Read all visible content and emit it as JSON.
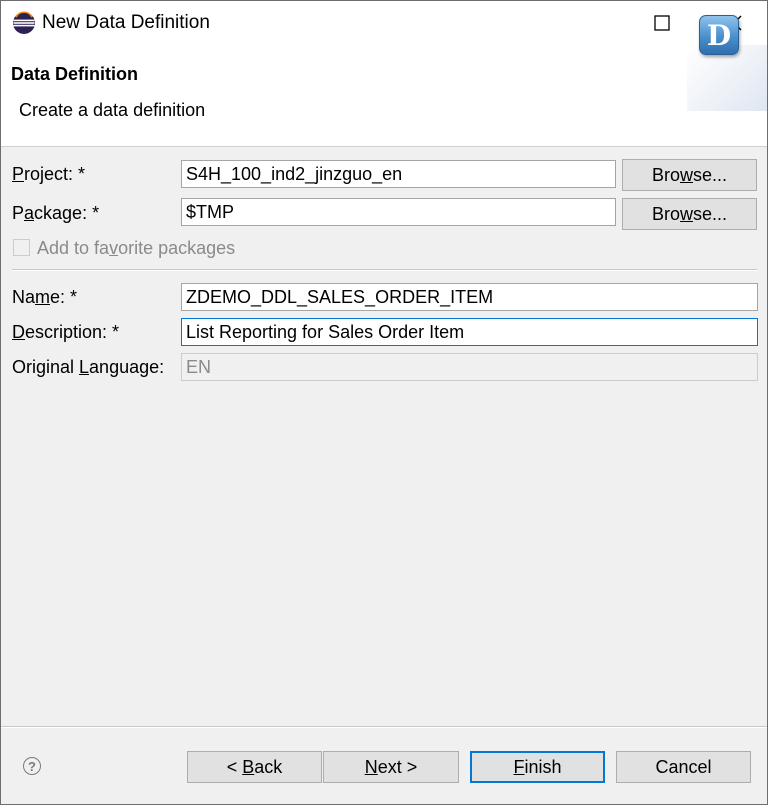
{
  "window": {
    "title": "New Data Definition",
    "controls": {
      "maximize": "maximize",
      "close": "close"
    }
  },
  "banner": {
    "title": "Data Definition",
    "description": "Create a data definition",
    "badge_letter": "D"
  },
  "form": {
    "project": {
      "label_mn": "P",
      "label_rest": "roject: *",
      "value": "S4H_100_ind2_jinzguo_en",
      "browse": {
        "pre": "Bro",
        "mn": "w",
        "post": "se..."
      }
    },
    "package": {
      "label_pre": "P",
      "label_mn": "a",
      "label_post": "ckage: *",
      "value": "$TMP",
      "browse": {
        "pre": "Bro",
        "mn": "w",
        "post": "se..."
      }
    },
    "favorite": {
      "label_pre": "Add to fa",
      "label_mn": "v",
      "label_post": "orite packages",
      "checked": false
    },
    "name": {
      "label_pre": "Na",
      "label_mn": "m",
      "label_post": "e: *",
      "value": "ZDEMO_DDL_SALES_ORDER_ITEM"
    },
    "description": {
      "label_mn": "D",
      "label_rest": "escription: *",
      "value": "List Reporting for Sales Order Item"
    },
    "original_language": {
      "label_pre": "Original ",
      "label_mn": "L",
      "label_post": "anguage:",
      "value": "EN"
    }
  },
  "footer": {
    "help_glyph": "?",
    "back": {
      "pre": "< ",
      "mn": "B",
      "post": "ack"
    },
    "next": {
      "mn": "N",
      "post": "ext >"
    },
    "finish": {
      "mn": "F",
      "post": "inish"
    },
    "cancel": "Cancel"
  },
  "colors": {
    "accent": "#0078d7",
    "dialog_bg": "#f0f0f0",
    "banner_bg": "#ffffff",
    "badge": "#4a8fcc"
  },
  "icons": [
    "eclipse-app-icon",
    "maximize-icon",
    "close-icon",
    "data-definition-badge-icon",
    "help-icon"
  ]
}
